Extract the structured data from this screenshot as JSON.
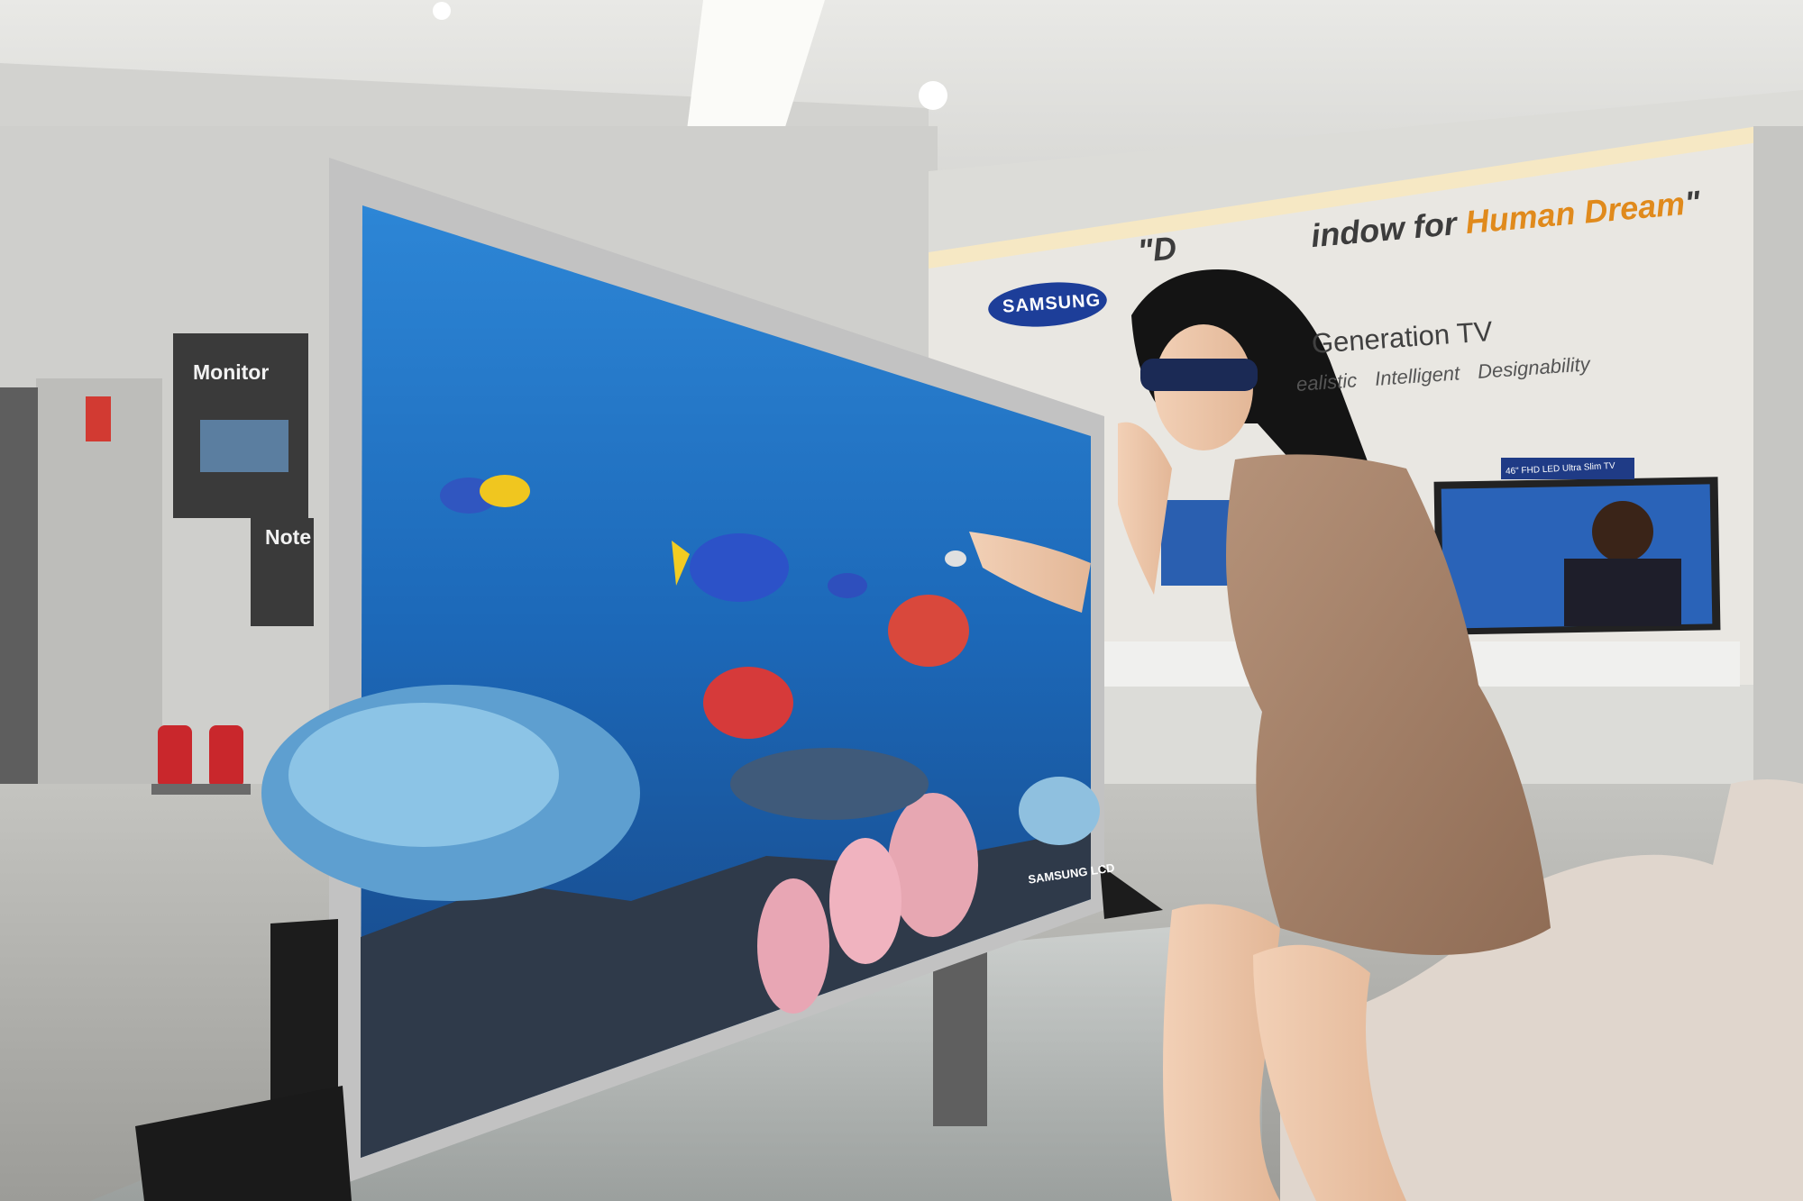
{
  "scene": {
    "banner": {
      "quote_start": "\"D",
      "quote_mid": "indow for ",
      "quote_accent": "Human Dream",
      "quote_end": "\"",
      "subtitle": "Generation TV",
      "features": "ealistic Intelligent Designability"
    },
    "samsung_logo_text": "SAMSUNG",
    "monitor_sign": "Monitor",
    "note_sign": "Note",
    "tv_brand": "SAMSUNG LCD",
    "display_badge": "46\" FHD LED Ultra Slim TV"
  },
  "colors": {
    "wall": "#d8d8d5",
    "ceiling": "#e7e7e4",
    "floor": "#b8b8b4",
    "tv_bezel": "#bcbcbc",
    "water": "#1f6fc2",
    "accent_orange": "#e08a1c",
    "samsung_blue": "#1d3e99"
  }
}
